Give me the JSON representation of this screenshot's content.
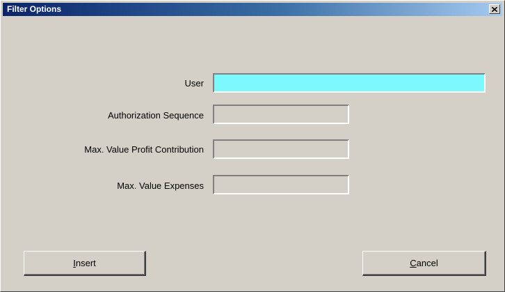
{
  "window": {
    "title": "Filter Options",
    "close_glyph": "×"
  },
  "form": {
    "user_label": "User",
    "user_value": "",
    "auth_seq_label": "Authorization Sequence",
    "auth_seq_value": "",
    "max_profit_label": "Max. Value Profit Contribution",
    "max_profit_value": "",
    "max_expenses_label": "Max. Value Expenses",
    "max_expenses_value": ""
  },
  "buttons": {
    "insert_mnemonic": "I",
    "insert_rest": "nsert",
    "cancel_mnemonic": "C",
    "cancel_rest": "ancel"
  },
  "colors": {
    "active_field": "#7cf9fc",
    "titlebar_start": "#0a246a",
    "titlebar_end": "#a6caf0",
    "dialog_bg": "#d4d0c8"
  },
  "icons": {
    "close": "close-icon"
  }
}
